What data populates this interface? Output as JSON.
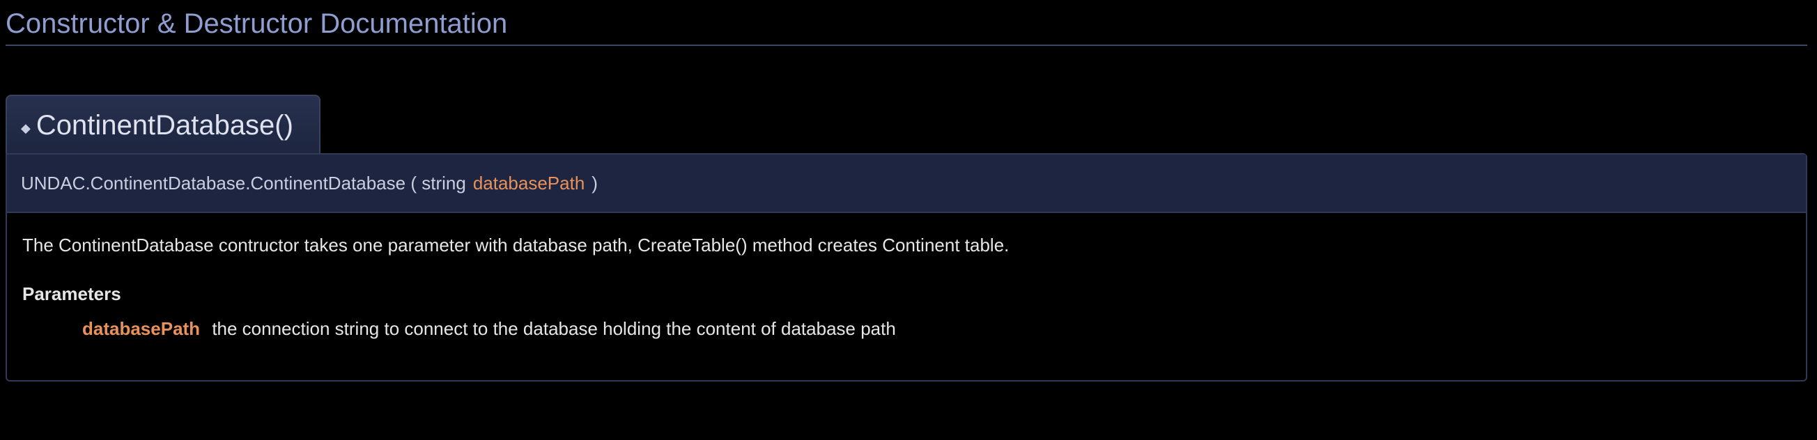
{
  "section": {
    "title": "Constructor & Destructor Documentation"
  },
  "member": {
    "anchor_symbol": "◆",
    "title": "ContinentDatabase()",
    "prototype": {
      "name": "UNDAC.ContinentDatabase.ContinentDatabase",
      "open_paren": "(",
      "param_type": "string",
      "param_name": "databasePath",
      "close_paren": ")"
    },
    "description": "The ContinentDatabase contructor takes one parameter with database path, CreateTable() method creates Continent table.",
    "parameters_heading": "Parameters",
    "parameters": [
      {
        "name": "databasePath",
        "description": "the connection string to connect to the database holding the content of database path"
      }
    ]
  },
  "colors": {
    "background": "#000000",
    "heading": "#8f9dd0",
    "param_accent": "#e8915a",
    "proto_background": "#1d2540"
  }
}
